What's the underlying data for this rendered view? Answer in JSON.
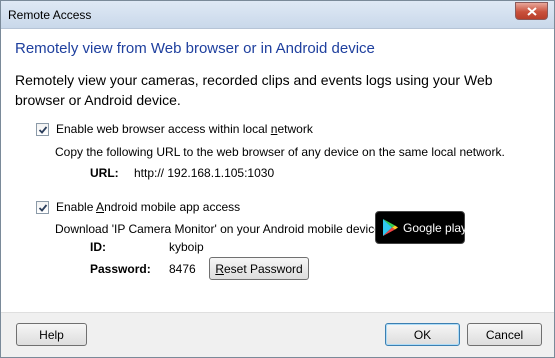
{
  "window": {
    "title": "Remote Access",
    "close_icon": "close-icon"
  },
  "heading": "Remotely view from Web browser or in Android device",
  "description": "Remotely view your cameras, recorded clips and events logs using your Web browser or Android device.",
  "web": {
    "checked": true,
    "label_pre": "Enable web browser access within local ",
    "label_ul": "n",
    "label_post": "etwork",
    "instruction": "Copy the following URL to the web browser of any device on the same local network.",
    "url_label": "URL:",
    "url_value": "http:// 192.168.1.105:1030"
  },
  "android": {
    "checked": true,
    "label_pre": "Enable ",
    "label_ul": "A",
    "label_post": "ndroid mobile app access",
    "instruction": "Download 'IP Camera Monitor' on your Android mobile device from",
    "id_label": "ID:",
    "id_value": "kyboip",
    "password_label": "Password:",
    "password_value": "8476",
    "reset_ul": "R",
    "reset_rest": "eset Password",
    "badge_text": "Google play",
    "badge_icon": "google-play-icon"
  },
  "footer": {
    "help": "Help",
    "ok": "OK",
    "cancel": "Cancel"
  }
}
